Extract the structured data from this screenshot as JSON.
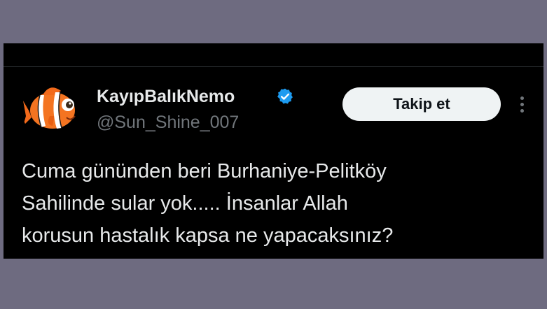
{
  "tweet": {
    "display_name": "KayıpBalıkNemo",
    "handle": "@Sun_Shine_007",
    "follow_label": "Takip et",
    "text": "Cuma gününden beri Burhaniye-Pelitköy\nSahilinde sular yok..... İnsanlar Allah\nkorusun hastalık kapsa ne yapacaksınız?",
    "avatar_icon": "clownfish-avatar-icon",
    "verified_icon": "verified-badge-icon",
    "more_icon": "more-options-icon"
  },
  "colors": {
    "background": "#000000",
    "frame": "#6e6b80",
    "text_primary": "#e7e9ea",
    "text_secondary": "#71767b",
    "verified_blue": "#1d9bf0",
    "follow_bg": "#eff3f4"
  }
}
